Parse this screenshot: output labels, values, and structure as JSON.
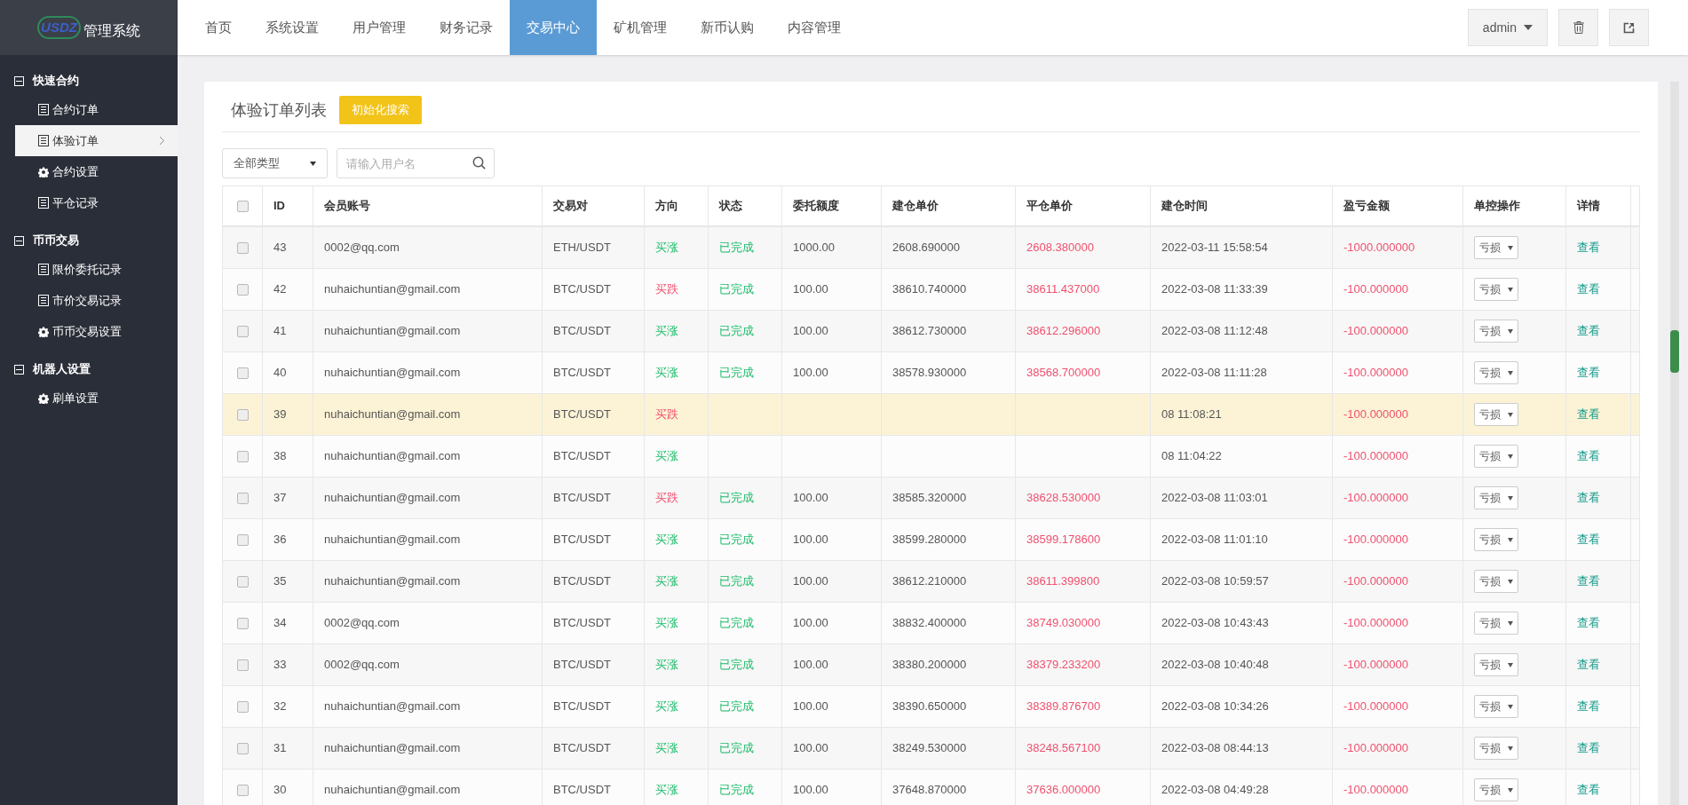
{
  "logo": {
    "mark": "USDZ",
    "title": "管理系统"
  },
  "nav": [
    {
      "label": "首页",
      "selected": false
    },
    {
      "label": "系统设置",
      "selected": false
    },
    {
      "label": "用户管理",
      "selected": false
    },
    {
      "label": "财务记录",
      "selected": false
    },
    {
      "label": "交易中心",
      "selected": true
    },
    {
      "label": "矿机管理",
      "selected": false
    },
    {
      "label": "新币认购",
      "selected": false
    },
    {
      "label": "内容管理",
      "selected": false
    }
  ],
  "user_menu": {
    "label": "admin"
  },
  "sidebar": [
    {
      "label": "快速合约",
      "expanded": true,
      "children": [
        {
          "label": "合约订单",
          "kind": "list",
          "selected": false
        },
        {
          "label": "体验订单",
          "kind": "list",
          "selected": true
        },
        {
          "label": "合约设置",
          "kind": "gear",
          "selected": false
        },
        {
          "label": "平仓记录",
          "kind": "list",
          "selected": false
        }
      ]
    },
    {
      "label": "币币交易",
      "expanded": true,
      "children": [
        {
          "label": "限价委托记录",
          "kind": "list",
          "selected": false
        },
        {
          "label": "市价交易记录",
          "kind": "list",
          "selected": false
        },
        {
          "label": "币币交易设置",
          "kind": "gear",
          "selected": false
        }
      ]
    },
    {
      "label": "机器人设置",
      "expanded": true,
      "children": [
        {
          "label": "刷单设置",
          "kind": "gear",
          "selected": false
        }
      ]
    }
  ],
  "panel": {
    "title": "体验订单列表",
    "reset_button": "初始化搜索"
  },
  "filters": {
    "type_select": "全部类型",
    "search": {
      "placeholder": "请输入用户名"
    }
  },
  "table": {
    "columns": [
      "ID",
      "会员账号",
      "交易对",
      "方向",
      "状态",
      "委托额度",
      "建仓单价",
      "平仓单价",
      "建仓时间",
      "盈亏金额",
      "单控操作",
      "详情"
    ],
    "select_all": false,
    "rows": [
      {
        "checked": false,
        "highlighted": false,
        "id": "43",
        "account": "0002@qq.com",
        "pair": "ETH/USDT",
        "direction": {
          "label": "买涨",
          "kind": "up"
        },
        "status": "已完成",
        "amount": "1000.00",
        "open": "2608.690000",
        "close": "2608.380000",
        "time": "2022-03-11 15:58:54",
        "pnl": "-1000.000000",
        "control": "亏损",
        "detail": "查看"
      },
      {
        "checked": false,
        "highlighted": false,
        "id": "42",
        "account": "nuhaichuntian@gmail.com",
        "pair": "BTC/USDT",
        "direction": {
          "label": "买跌",
          "kind": "down"
        },
        "status": "已完成",
        "amount": "100.00",
        "open": "38610.740000",
        "close": "38611.437000",
        "time": "2022-03-08 11:33:39",
        "pnl": "-100.000000",
        "control": "亏损",
        "detail": "查看"
      },
      {
        "checked": false,
        "highlighted": false,
        "id": "41",
        "account": "nuhaichuntian@gmail.com",
        "pair": "BTC/USDT",
        "direction": {
          "label": "买涨",
          "kind": "up"
        },
        "status": "已完成",
        "amount": "100.00",
        "open": "38612.730000",
        "close": "38612.296000",
        "time": "2022-03-08 11:12:48",
        "pnl": "-100.000000",
        "control": "亏损",
        "detail": "查看"
      },
      {
        "checked": false,
        "highlighted": false,
        "id": "40",
        "account": "nuhaichuntian@gmail.com",
        "pair": "BTC/USDT",
        "direction": {
          "label": "买涨",
          "kind": "up"
        },
        "status": "已完成",
        "amount": "100.00",
        "open": "38578.930000",
        "close": "38568.700000",
        "time": "2022-03-08 11:11:28",
        "pnl": "-100.000000",
        "control": "亏损",
        "detail": "查看"
      },
      {
        "checked": false,
        "highlighted": true,
        "id": "39",
        "account": "nuhaichuntian@gmail.com",
        "pair": "BTC/USDT",
        "direction": {
          "label": "买跌",
          "kind": "down"
        },
        "time": "08 11:08:21",
        "pnl": "-100.000000",
        "control": "亏损",
        "detail": "查看"
      },
      {
        "checked": false,
        "highlighted": false,
        "id": "38",
        "account": "nuhaichuntian@gmail.com",
        "pair": "BTC/USDT",
        "direction": {
          "label": "买涨",
          "kind": "up"
        },
        "time": "08 11:04:22",
        "pnl": "-100.000000",
        "control": "亏损",
        "detail": "查看"
      },
      {
        "checked": false,
        "highlighted": false,
        "id": "37",
        "account": "nuhaichuntian@gmail.com",
        "pair": "BTC/USDT",
        "direction": {
          "label": "买跌",
          "kind": "down"
        },
        "status": "已完成",
        "amount": "100.00",
        "open": "38585.320000",
        "close": "38628.530000",
        "time": "2022-03-08 11:03:01",
        "pnl": "-100.000000",
        "control": "亏损",
        "detail": "查看"
      },
      {
        "checked": false,
        "highlighted": false,
        "id": "36",
        "account": "nuhaichuntian@gmail.com",
        "pair": "BTC/USDT",
        "direction": {
          "label": "买涨",
          "kind": "up"
        },
        "status": "已完成",
        "amount": "100.00",
        "open": "38599.280000",
        "close": "38599.178600",
        "time": "2022-03-08 11:01:10",
        "pnl": "-100.000000",
        "control": "亏损",
        "detail": "查看"
      },
      {
        "checked": false,
        "highlighted": false,
        "id": "35",
        "account": "nuhaichuntian@gmail.com",
        "pair": "BTC/USDT",
        "direction": {
          "label": "买涨",
          "kind": "up"
        },
        "status": "已完成",
        "amount": "100.00",
        "open": "38612.210000",
        "close": "38611.399800",
        "time": "2022-03-08 10:59:57",
        "pnl": "-100.000000",
        "control": "亏损",
        "detail": "查看"
      },
      {
        "checked": false,
        "highlighted": false,
        "id": "34",
        "account": "0002@qq.com",
        "pair": "BTC/USDT",
        "direction": {
          "label": "买涨",
          "kind": "up"
        },
        "status": "已完成",
        "amount": "100.00",
        "open": "38832.400000",
        "close": "38749.030000",
        "time": "2022-03-08 10:43:43",
        "pnl": "-100.000000",
        "control": "亏损",
        "detail": "查看"
      },
      {
        "checked": false,
        "highlighted": false,
        "id": "33",
        "account": "0002@qq.com",
        "pair": "BTC/USDT",
        "direction": {
          "label": "买涨",
          "kind": "up"
        },
        "status": "已完成",
        "amount": "100.00",
        "open": "38380.200000",
        "close": "38379.233200",
        "time": "2022-03-08 10:40:48",
        "pnl": "-100.000000",
        "control": "亏损",
        "detail": "查看"
      },
      {
        "checked": false,
        "highlighted": false,
        "id": "32",
        "account": "nuhaichuntian@gmail.com",
        "pair": "BTC/USDT",
        "direction": {
          "label": "买涨",
          "kind": "up"
        },
        "status": "已完成",
        "amount": "100.00",
        "open": "38390.650000",
        "close": "38389.876700",
        "time": "2022-03-08 10:34:26",
        "pnl": "-100.000000",
        "control": "亏损",
        "detail": "查看"
      },
      {
        "checked": false,
        "highlighted": false,
        "id": "31",
        "account": "nuhaichuntian@gmail.com",
        "pair": "BTC/USDT",
        "direction": {
          "label": "买涨",
          "kind": "up"
        },
        "status": "已完成",
        "amount": "100.00",
        "open": "38249.530000",
        "close": "38248.567100",
        "time": "2022-03-08 08:44:13",
        "pnl": "-100.000000",
        "control": "亏损",
        "detail": "查看"
      },
      {
        "checked": false,
        "highlighted": false,
        "id": "30",
        "account": "nuhaichuntian@gmail.com",
        "pair": "BTC/USDT",
        "direction": {
          "label": "买涨",
          "kind": "up"
        },
        "status": "已完成",
        "amount": "100.00",
        "open": "37648.870000",
        "close": "37636.000000",
        "time": "2022-03-08 04:49:28",
        "pnl": "-100.000000",
        "control": "亏损",
        "detail": "查看"
      }
    ]
  }
}
